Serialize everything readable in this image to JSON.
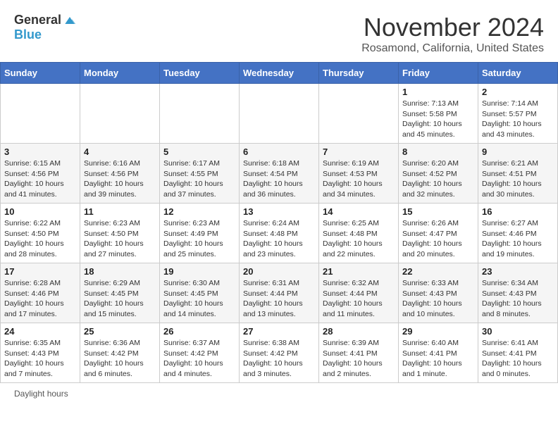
{
  "header": {
    "logo_general": "General",
    "logo_blue": "Blue",
    "title": "November 2024",
    "location": "Rosamond, California, United States"
  },
  "days_of_week": [
    "Sunday",
    "Monday",
    "Tuesday",
    "Wednesday",
    "Thursday",
    "Friday",
    "Saturday"
  ],
  "weeks": [
    [
      {
        "day": "",
        "info": ""
      },
      {
        "day": "",
        "info": ""
      },
      {
        "day": "",
        "info": ""
      },
      {
        "day": "",
        "info": ""
      },
      {
        "day": "",
        "info": ""
      },
      {
        "day": "1",
        "info": "Sunrise: 7:13 AM\nSunset: 5:58 PM\nDaylight: 10 hours and 45 minutes."
      },
      {
        "day": "2",
        "info": "Sunrise: 7:14 AM\nSunset: 5:57 PM\nDaylight: 10 hours and 43 minutes."
      }
    ],
    [
      {
        "day": "3",
        "info": "Sunrise: 6:15 AM\nSunset: 4:56 PM\nDaylight: 10 hours and 41 minutes."
      },
      {
        "day": "4",
        "info": "Sunrise: 6:16 AM\nSunset: 4:56 PM\nDaylight: 10 hours and 39 minutes."
      },
      {
        "day": "5",
        "info": "Sunrise: 6:17 AM\nSunset: 4:55 PM\nDaylight: 10 hours and 37 minutes."
      },
      {
        "day": "6",
        "info": "Sunrise: 6:18 AM\nSunset: 4:54 PM\nDaylight: 10 hours and 36 minutes."
      },
      {
        "day": "7",
        "info": "Sunrise: 6:19 AM\nSunset: 4:53 PM\nDaylight: 10 hours and 34 minutes."
      },
      {
        "day": "8",
        "info": "Sunrise: 6:20 AM\nSunset: 4:52 PM\nDaylight: 10 hours and 32 minutes."
      },
      {
        "day": "9",
        "info": "Sunrise: 6:21 AM\nSunset: 4:51 PM\nDaylight: 10 hours and 30 minutes."
      }
    ],
    [
      {
        "day": "10",
        "info": "Sunrise: 6:22 AM\nSunset: 4:50 PM\nDaylight: 10 hours and 28 minutes."
      },
      {
        "day": "11",
        "info": "Sunrise: 6:23 AM\nSunset: 4:50 PM\nDaylight: 10 hours and 27 minutes."
      },
      {
        "day": "12",
        "info": "Sunrise: 6:23 AM\nSunset: 4:49 PM\nDaylight: 10 hours and 25 minutes."
      },
      {
        "day": "13",
        "info": "Sunrise: 6:24 AM\nSunset: 4:48 PM\nDaylight: 10 hours and 23 minutes."
      },
      {
        "day": "14",
        "info": "Sunrise: 6:25 AM\nSunset: 4:48 PM\nDaylight: 10 hours and 22 minutes."
      },
      {
        "day": "15",
        "info": "Sunrise: 6:26 AM\nSunset: 4:47 PM\nDaylight: 10 hours and 20 minutes."
      },
      {
        "day": "16",
        "info": "Sunrise: 6:27 AM\nSunset: 4:46 PM\nDaylight: 10 hours and 19 minutes."
      }
    ],
    [
      {
        "day": "17",
        "info": "Sunrise: 6:28 AM\nSunset: 4:46 PM\nDaylight: 10 hours and 17 minutes."
      },
      {
        "day": "18",
        "info": "Sunrise: 6:29 AM\nSunset: 4:45 PM\nDaylight: 10 hours and 15 minutes."
      },
      {
        "day": "19",
        "info": "Sunrise: 6:30 AM\nSunset: 4:45 PM\nDaylight: 10 hours and 14 minutes."
      },
      {
        "day": "20",
        "info": "Sunrise: 6:31 AM\nSunset: 4:44 PM\nDaylight: 10 hours and 13 minutes."
      },
      {
        "day": "21",
        "info": "Sunrise: 6:32 AM\nSunset: 4:44 PM\nDaylight: 10 hours and 11 minutes."
      },
      {
        "day": "22",
        "info": "Sunrise: 6:33 AM\nSunset: 4:43 PM\nDaylight: 10 hours and 10 minutes."
      },
      {
        "day": "23",
        "info": "Sunrise: 6:34 AM\nSunset: 4:43 PM\nDaylight: 10 hours and 8 minutes."
      }
    ],
    [
      {
        "day": "24",
        "info": "Sunrise: 6:35 AM\nSunset: 4:43 PM\nDaylight: 10 hours and 7 minutes."
      },
      {
        "day": "25",
        "info": "Sunrise: 6:36 AM\nSunset: 4:42 PM\nDaylight: 10 hours and 6 minutes."
      },
      {
        "day": "26",
        "info": "Sunrise: 6:37 AM\nSunset: 4:42 PM\nDaylight: 10 hours and 4 minutes."
      },
      {
        "day": "27",
        "info": "Sunrise: 6:38 AM\nSunset: 4:42 PM\nDaylight: 10 hours and 3 minutes."
      },
      {
        "day": "28",
        "info": "Sunrise: 6:39 AM\nSunset: 4:41 PM\nDaylight: 10 hours and 2 minutes."
      },
      {
        "day": "29",
        "info": "Sunrise: 6:40 AM\nSunset: 4:41 PM\nDaylight: 10 hours and 1 minute."
      },
      {
        "day": "30",
        "info": "Sunrise: 6:41 AM\nSunset: 4:41 PM\nDaylight: 10 hours and 0 minutes."
      }
    ]
  ],
  "footer": {
    "daylight_label": "Daylight hours"
  }
}
